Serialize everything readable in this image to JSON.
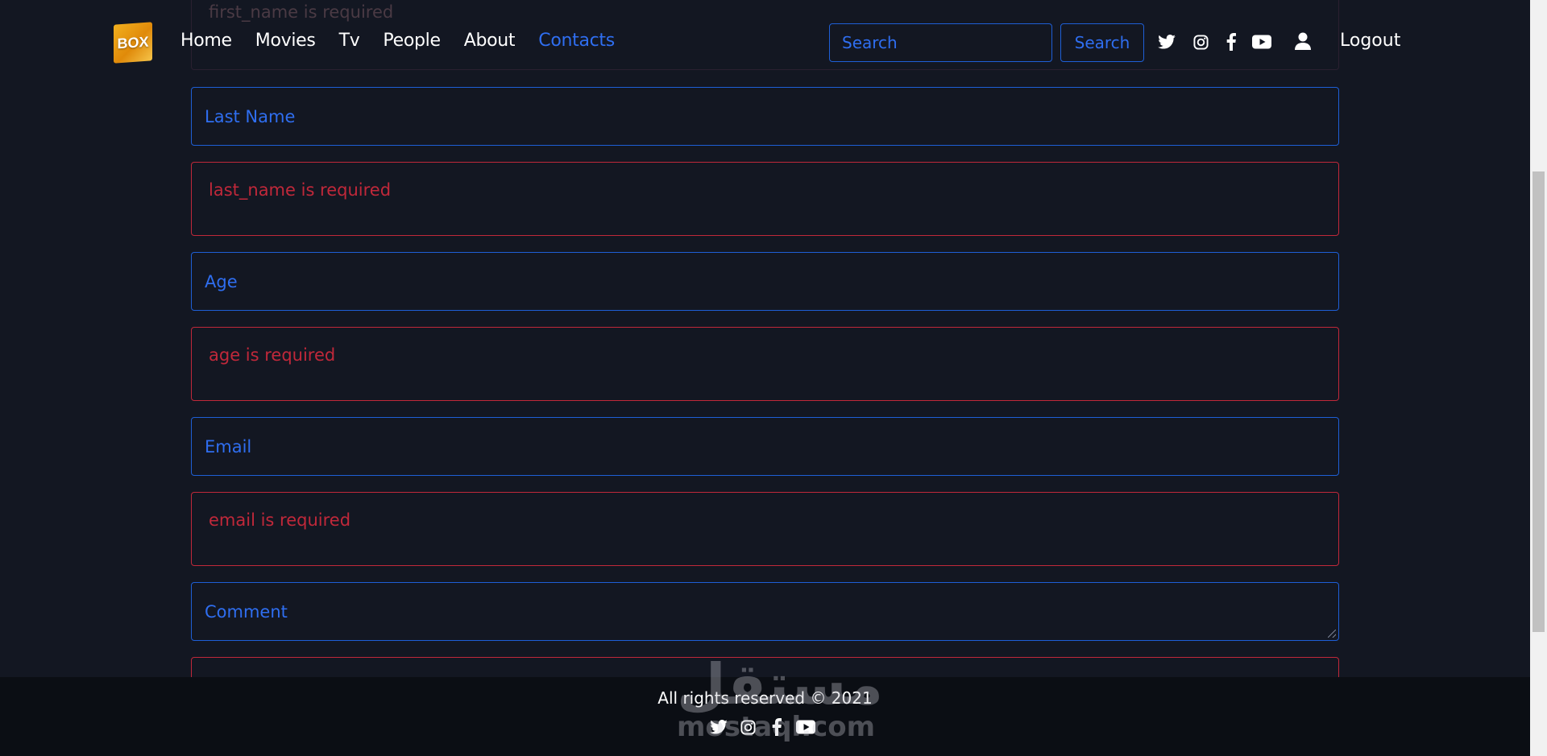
{
  "navbar": {
    "logo_text": "BOX",
    "links": [
      "Home",
      "Movies",
      "Tv",
      "People",
      "About",
      "Contacts"
    ],
    "active_link": "Contacts",
    "search_placeholder": "Search",
    "search_button": "Search",
    "social_icons": [
      "twitter-icon",
      "instagram-icon",
      "facebook-icon",
      "youtube-icon"
    ],
    "user_icon": "user-icon",
    "logout": "Logout"
  },
  "form": {
    "first_name_error": "first_name is required",
    "last_name_placeholder": "Last Name",
    "last_name_error": "last_name is required",
    "age_placeholder": "Age",
    "age_error": "age is required",
    "email_placeholder": "Email",
    "email_error": "email is required",
    "comment_placeholder": "Comment"
  },
  "footer": {
    "copyright": "All rights reserved © 2021",
    "social_icons": [
      "twitter-icon",
      "instagram-icon",
      "facebook-icon",
      "youtube-icon"
    ]
  },
  "watermark": {
    "arabic": "مستقل",
    "latin": "mostaql.com"
  },
  "colors": {
    "background": "#131722",
    "accent": "#2f6ef0",
    "error": "#c0283a",
    "footer": "#0b0e14"
  }
}
